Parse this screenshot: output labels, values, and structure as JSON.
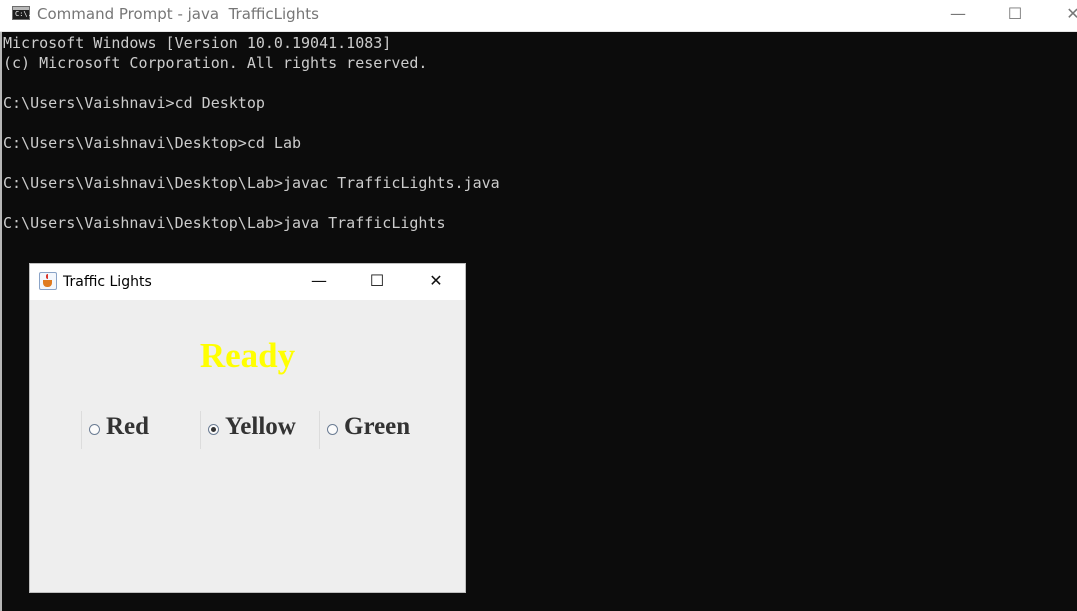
{
  "cmd": {
    "title": "Command Prompt - java  TrafficLights",
    "icon_text": "C:\\.",
    "controls": {
      "minimize": "—",
      "maximize": "☐",
      "close": "✕"
    },
    "lines": [
      "Microsoft Windows [Version 10.0.19041.1083]",
      "(c) Microsoft Corporation. All rights reserved.",
      "",
      "C:\\Users\\Vaishnavi>cd Desktop",
      "",
      "C:\\Users\\Vaishnavi\\Desktop>cd Lab",
      "",
      "C:\\Users\\Vaishnavi\\Desktop\\Lab>javac TrafficLights.java",
      "",
      "C:\\Users\\Vaishnavi\\Desktop\\Lab>java TrafficLights"
    ]
  },
  "traffic_window": {
    "title": "Traffic Lights",
    "controls": {
      "minimize": "—",
      "maximize": "☐",
      "close": "✕"
    },
    "status": "Ready",
    "status_color": "#ffff00",
    "radios": [
      {
        "label": "Red",
        "checked": false
      },
      {
        "label": "Yellow",
        "checked": true
      },
      {
        "label": "Green",
        "checked": false
      }
    ]
  }
}
